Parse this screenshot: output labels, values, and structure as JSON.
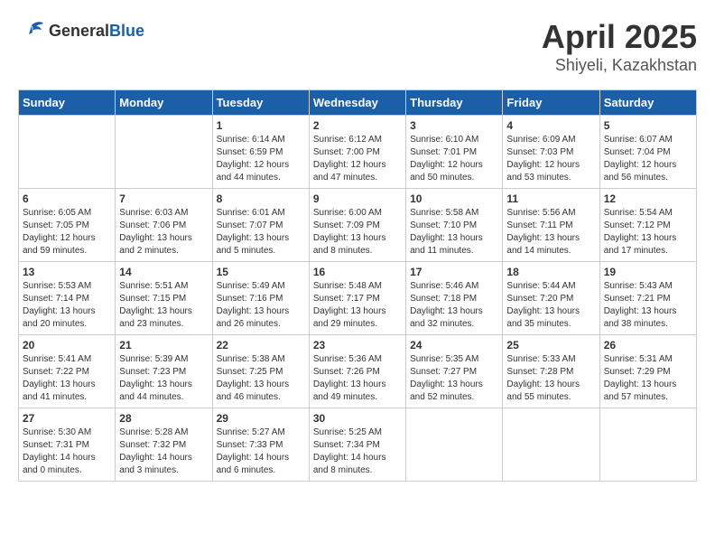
{
  "logo": {
    "general": "General",
    "blue": "Blue"
  },
  "header": {
    "month": "April 2025",
    "location": "Shiyeli, Kazakhstan"
  },
  "weekdays": [
    "Sunday",
    "Monday",
    "Tuesday",
    "Wednesday",
    "Thursday",
    "Friday",
    "Saturday"
  ],
  "weeks": [
    [
      {
        "day": "",
        "info": ""
      },
      {
        "day": "",
        "info": ""
      },
      {
        "day": "1",
        "info": "Sunrise: 6:14 AM\nSunset: 6:59 PM\nDaylight: 12 hours\nand 44 minutes."
      },
      {
        "day": "2",
        "info": "Sunrise: 6:12 AM\nSunset: 7:00 PM\nDaylight: 12 hours\nand 47 minutes."
      },
      {
        "day": "3",
        "info": "Sunrise: 6:10 AM\nSunset: 7:01 PM\nDaylight: 12 hours\nand 50 minutes."
      },
      {
        "day": "4",
        "info": "Sunrise: 6:09 AM\nSunset: 7:03 PM\nDaylight: 12 hours\nand 53 minutes."
      },
      {
        "day": "5",
        "info": "Sunrise: 6:07 AM\nSunset: 7:04 PM\nDaylight: 12 hours\nand 56 minutes."
      }
    ],
    [
      {
        "day": "6",
        "info": "Sunrise: 6:05 AM\nSunset: 7:05 PM\nDaylight: 12 hours\nand 59 minutes."
      },
      {
        "day": "7",
        "info": "Sunrise: 6:03 AM\nSunset: 7:06 PM\nDaylight: 13 hours\nand 2 minutes."
      },
      {
        "day": "8",
        "info": "Sunrise: 6:01 AM\nSunset: 7:07 PM\nDaylight: 13 hours\nand 5 minutes."
      },
      {
        "day": "9",
        "info": "Sunrise: 6:00 AM\nSunset: 7:09 PM\nDaylight: 13 hours\nand 8 minutes."
      },
      {
        "day": "10",
        "info": "Sunrise: 5:58 AM\nSunset: 7:10 PM\nDaylight: 13 hours\nand 11 minutes."
      },
      {
        "day": "11",
        "info": "Sunrise: 5:56 AM\nSunset: 7:11 PM\nDaylight: 13 hours\nand 14 minutes."
      },
      {
        "day": "12",
        "info": "Sunrise: 5:54 AM\nSunset: 7:12 PM\nDaylight: 13 hours\nand 17 minutes."
      }
    ],
    [
      {
        "day": "13",
        "info": "Sunrise: 5:53 AM\nSunset: 7:14 PM\nDaylight: 13 hours\nand 20 minutes."
      },
      {
        "day": "14",
        "info": "Sunrise: 5:51 AM\nSunset: 7:15 PM\nDaylight: 13 hours\nand 23 minutes."
      },
      {
        "day": "15",
        "info": "Sunrise: 5:49 AM\nSunset: 7:16 PM\nDaylight: 13 hours\nand 26 minutes."
      },
      {
        "day": "16",
        "info": "Sunrise: 5:48 AM\nSunset: 7:17 PM\nDaylight: 13 hours\nand 29 minutes."
      },
      {
        "day": "17",
        "info": "Sunrise: 5:46 AM\nSunset: 7:18 PM\nDaylight: 13 hours\nand 32 minutes."
      },
      {
        "day": "18",
        "info": "Sunrise: 5:44 AM\nSunset: 7:20 PM\nDaylight: 13 hours\nand 35 minutes."
      },
      {
        "day": "19",
        "info": "Sunrise: 5:43 AM\nSunset: 7:21 PM\nDaylight: 13 hours\nand 38 minutes."
      }
    ],
    [
      {
        "day": "20",
        "info": "Sunrise: 5:41 AM\nSunset: 7:22 PM\nDaylight: 13 hours\nand 41 minutes."
      },
      {
        "day": "21",
        "info": "Sunrise: 5:39 AM\nSunset: 7:23 PM\nDaylight: 13 hours\nand 44 minutes."
      },
      {
        "day": "22",
        "info": "Sunrise: 5:38 AM\nSunset: 7:25 PM\nDaylight: 13 hours\nand 46 minutes."
      },
      {
        "day": "23",
        "info": "Sunrise: 5:36 AM\nSunset: 7:26 PM\nDaylight: 13 hours\nand 49 minutes."
      },
      {
        "day": "24",
        "info": "Sunrise: 5:35 AM\nSunset: 7:27 PM\nDaylight: 13 hours\nand 52 minutes."
      },
      {
        "day": "25",
        "info": "Sunrise: 5:33 AM\nSunset: 7:28 PM\nDaylight: 13 hours\nand 55 minutes."
      },
      {
        "day": "26",
        "info": "Sunrise: 5:31 AM\nSunset: 7:29 PM\nDaylight: 13 hours\nand 57 minutes."
      }
    ],
    [
      {
        "day": "27",
        "info": "Sunrise: 5:30 AM\nSunset: 7:31 PM\nDaylight: 14 hours\nand 0 minutes."
      },
      {
        "day": "28",
        "info": "Sunrise: 5:28 AM\nSunset: 7:32 PM\nDaylight: 14 hours\nand 3 minutes."
      },
      {
        "day": "29",
        "info": "Sunrise: 5:27 AM\nSunset: 7:33 PM\nDaylight: 14 hours\nand 6 minutes."
      },
      {
        "day": "30",
        "info": "Sunrise: 5:25 AM\nSunset: 7:34 PM\nDaylight: 14 hours\nand 8 minutes."
      },
      {
        "day": "",
        "info": ""
      },
      {
        "day": "",
        "info": ""
      },
      {
        "day": "",
        "info": ""
      }
    ]
  ]
}
